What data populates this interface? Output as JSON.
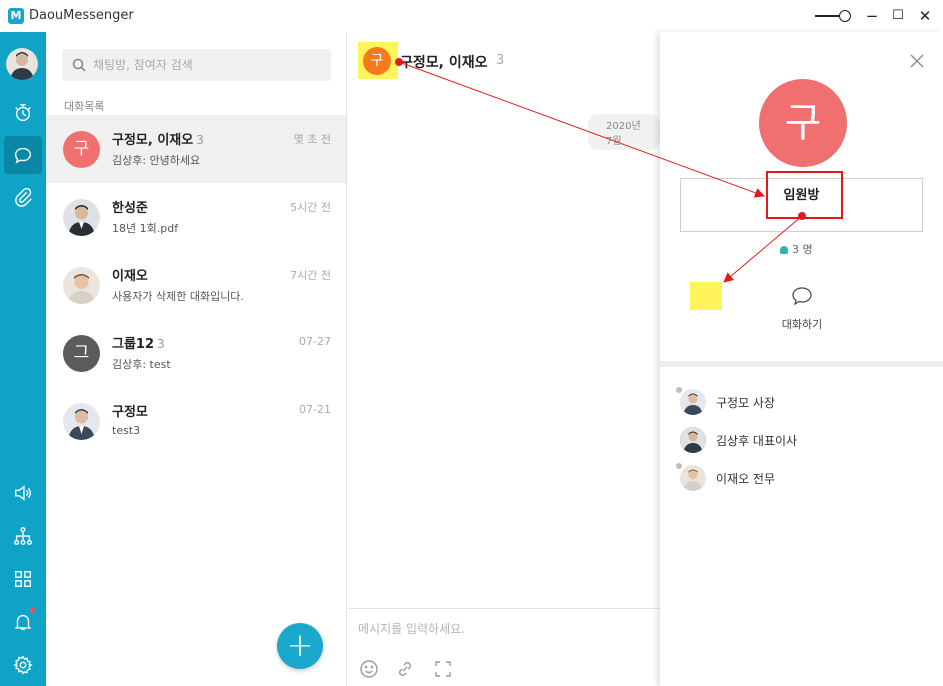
{
  "window": {
    "title": "DaouMessenger",
    "logo_glyph": "M",
    "controls": {
      "minimize": "−",
      "maximize": "☐",
      "close": "✕"
    }
  },
  "rail": {
    "items": [
      {
        "name": "profile-avatar"
      },
      {
        "name": "timer-icon"
      },
      {
        "name": "chat-bubble-icon",
        "active": true
      },
      {
        "name": "paperclip-icon"
      },
      {
        "name": "speaker-icon"
      },
      {
        "name": "org-chart-icon"
      },
      {
        "name": "grid-icon"
      },
      {
        "name": "bell-icon",
        "notification": true
      },
      {
        "name": "gear-icon"
      }
    ],
    "accent_color": "#0fa3c7"
  },
  "chatlist": {
    "search_placeholder": "채팅방, 참여자 검색",
    "section_label": "대화목록",
    "rows": [
      {
        "name": "구정모, 이재오",
        "count": "3",
        "time": "몇 초 전",
        "preview": "김상후: 안녕하세요",
        "avatar_text": "구",
        "avatar_color": "#f07070"
      },
      {
        "name": "한성준",
        "count": "",
        "time": "5시간 전",
        "preview": "18년 1회.pdf",
        "avatar_text": "",
        "avatar_color": "#3c4650"
      },
      {
        "name": "이재오",
        "count": "",
        "time": "7시간 전",
        "preview": "사용자가 삭제한 대화입니다.",
        "avatar_text": "",
        "avatar_color": "#d9c9b8"
      },
      {
        "name": "그룹12",
        "count": "3",
        "time": "07-27",
        "preview": "김상후: test",
        "avatar_text": "그",
        "avatar_color": "#5b5b5b"
      },
      {
        "name": "구정모",
        "count": "",
        "time": "07-21",
        "preview": "test3",
        "avatar_text": "",
        "avatar_color": "#aab8c4"
      }
    ],
    "new_chat_label": "+"
  },
  "conversation": {
    "avatar_text": "구",
    "title": "구정모, 이재오",
    "count": "3",
    "date_divider": "2020년 7월",
    "input_placeholder": "메시지를 입력하세요."
  },
  "info_panel": {
    "avatar_text": "구",
    "room_name": "임원방",
    "member_count": "3 명",
    "chat_action_label": "대화하기",
    "members": [
      {
        "name": "구정모 사장",
        "online": false
      },
      {
        "name": "김상후 대표이사",
        "online": false
      },
      {
        "name": "이재오 전무",
        "online": false
      }
    ]
  },
  "annotations": {
    "arrow_color": "#e11b1b",
    "highlight_color": "#fff45a"
  }
}
